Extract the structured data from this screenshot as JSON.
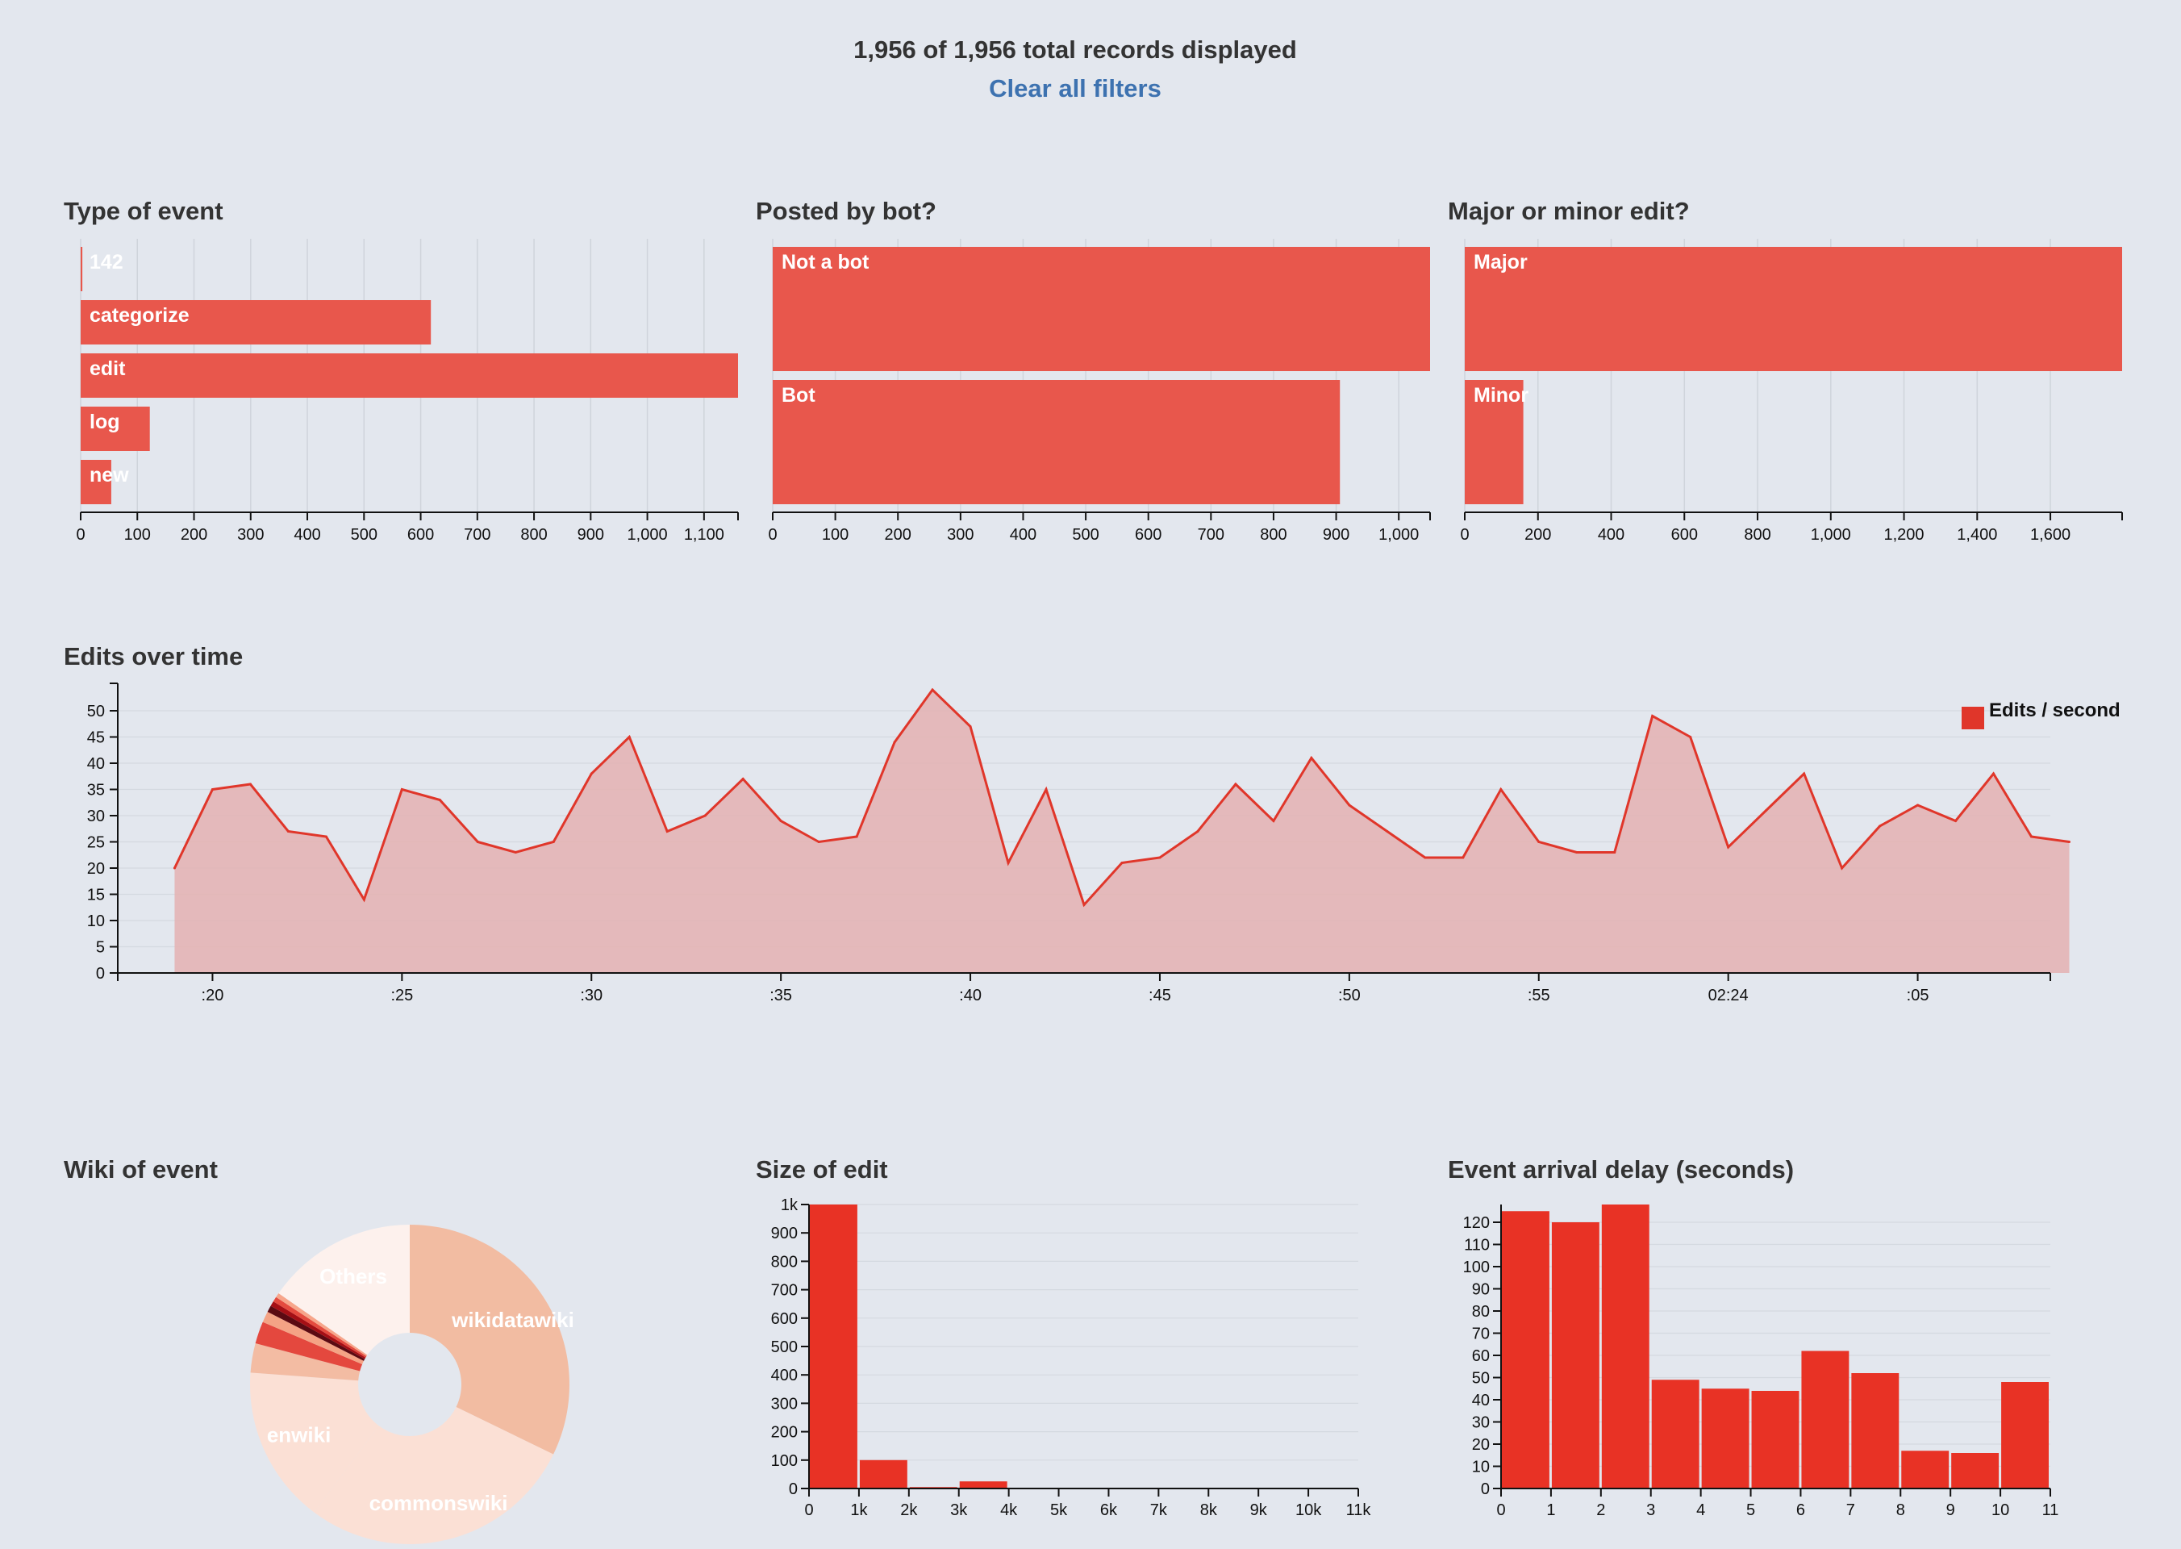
{
  "header": {
    "records_text": "1,956 of 1,956 total records displayed",
    "clear_filters": "Clear all filters"
  },
  "colors": {
    "bar": "#e8574c",
    "line": "#e0362a",
    "area": "#e3b4b5",
    "histogram": "#e83225",
    "grid": "#cfd4db"
  },
  "chart_data": [
    {
      "id": "type_of_event",
      "type": "bar",
      "orientation": "horizontal",
      "title": "Type of event",
      "categories": [
        "142",
        "categorize",
        "edit",
        "log",
        "new"
      ],
      "values": [
        3,
        618,
        1160,
        122,
        54
      ],
      "xlim": [
        0,
        1160
      ],
      "ticks": [
        0,
        100,
        200,
        300,
        400,
        500,
        600,
        700,
        800,
        900,
        1000,
        1100
      ],
      "tick_labels": [
        "0",
        "100",
        "200",
        "300",
        "400",
        "500",
        "600",
        "700",
        "800",
        "900",
        "1,000",
        "1,100"
      ],
      "grid": true
    },
    {
      "id": "posted_by_bot",
      "type": "bar",
      "orientation": "horizontal",
      "title": "Posted by bot?",
      "categories": [
        "Not a bot",
        "Bot"
      ],
      "values": [
        1050,
        906
      ],
      "xlim": [
        0,
        1050
      ],
      "ticks": [
        0,
        100,
        200,
        300,
        400,
        500,
        600,
        700,
        800,
        900,
        1000
      ],
      "tick_labels": [
        "0",
        "100",
        "200",
        "300",
        "400",
        "500",
        "600",
        "700",
        "800",
        "900",
        "1,000"
      ],
      "grid": true
    },
    {
      "id": "major_minor",
      "type": "bar",
      "orientation": "horizontal",
      "title": "Major or minor edit?",
      "categories": [
        "Major",
        "Minor"
      ],
      "values": [
        1796,
        160
      ],
      "xlim": [
        0,
        1796
      ],
      "ticks": [
        0,
        200,
        400,
        600,
        800,
        1000,
        1200,
        1400,
        1600
      ],
      "tick_labels": [
        "0",
        "200",
        "400",
        "600",
        "800",
        "1,000",
        "1,200",
        "1,400",
        "1,600"
      ],
      "grid": true
    },
    {
      "id": "edits_over_time",
      "type": "area",
      "title": "Edits over time",
      "series": [
        {
          "name": "Edits / second",
          "values": [
            20,
            35,
            36,
            27,
            26,
            14,
            35,
            33,
            25,
            23,
            25,
            38,
            45,
            27,
            30,
            37,
            29,
            25,
            26,
            44,
            54,
            47,
            21,
            35,
            13,
            21,
            22,
            27,
            36,
            29,
            41,
            32,
            27,
            22,
            22,
            35,
            25,
            23,
            23,
            49,
            45,
            24,
            31,
            38,
            20,
            28,
            32,
            29,
            38,
            26,
            25
          ]
        }
      ],
      "x_range": [
        -1.5,
        49.5
      ],
      "x_tick_positions": [
        1,
        6,
        11,
        16,
        21,
        26,
        31,
        36,
        41,
        46
      ],
      "x_tick_labels": [
        ":20",
        ":25",
        ":30",
        ":35",
        ":40",
        ":45",
        ":50",
        ":55",
        "02:24",
        ":05"
      ],
      "ylim": [
        0,
        54
      ],
      "y_ticks": [
        0,
        5,
        10,
        15,
        20,
        25,
        30,
        35,
        40,
        45,
        50
      ],
      "legend": "top-right",
      "grid": true
    },
    {
      "id": "wiki_of_event",
      "type": "pie",
      "title": "Wiki of event",
      "donut": true,
      "slices": [
        {
          "label": "wikidatawiki",
          "value": 630,
          "color": "#f2bca2"
        },
        {
          "label": "commonswiki",
          "value": 548,
          "color": "#fbe0d5"
        },
        {
          "label": "enwiki",
          "value": 312,
          "color": "#fbe0d5"
        },
        {
          "label": "",
          "value": 58,
          "color": "#f3bca3"
        },
        {
          "label": "",
          "value": 44,
          "color": "#e4483e"
        },
        {
          "label": "",
          "value": 22,
          "color": "#f4a385"
        },
        {
          "label": "",
          "value": 13,
          "color": "#5b0a12"
        },
        {
          "label": "",
          "value": 10,
          "color": "#a50f15"
        },
        {
          "label": "",
          "value": 10,
          "color": "#e44a3e"
        },
        {
          "label": "",
          "value": 9,
          "color": "#f7a58a"
        },
        {
          "label": "Others",
          "value": 300,
          "color": "#fdf1ed"
        }
      ]
    },
    {
      "id": "size_of_edit",
      "type": "bar",
      "title": "Size of edit",
      "bins": [
        [
          0,
          1000
        ],
        [
          1000,
          2000
        ],
        [
          2000,
          3000
        ],
        [
          3000,
          4000
        ]
      ],
      "values": [
        1000,
        100,
        5,
        25
      ],
      "xlim": [
        0,
        11000
      ],
      "x_ticks": [
        "0",
        "1k",
        "2k",
        "3k",
        "4k",
        "5k",
        "6k",
        "7k",
        "8k",
        "9k",
        "10k",
        "11k"
      ],
      "ylim": [
        0,
        1000
      ],
      "y_ticks": [
        "0",
        "100",
        "200",
        "300",
        "400",
        "500",
        "600",
        "700",
        "800",
        "900",
        "1k"
      ],
      "grid": true
    },
    {
      "id": "event_arrival_delay",
      "type": "bar",
      "title": "Event arrival delay (seconds)",
      "categories": [
        "0-1",
        "1-2",
        "2-3",
        "3-4",
        "4-5",
        "5-6",
        "6-7",
        "7-8",
        "8-9",
        "9-10",
        "10-11"
      ],
      "values": [
        125,
        120,
        128,
        49,
        45,
        44,
        62,
        52,
        17,
        16,
        48
      ],
      "xlim": [
        0,
        11
      ],
      "x_ticks": [
        "0",
        "1",
        "2",
        "3",
        "4",
        "5",
        "6",
        "7",
        "8",
        "9",
        "10",
        "11"
      ],
      "ylim": [
        0,
        128
      ],
      "y_ticks": [
        "0",
        "10",
        "20",
        "30",
        "40",
        "50",
        "60",
        "70",
        "80",
        "90",
        "100",
        "110",
        "120"
      ],
      "grid": true
    }
  ]
}
